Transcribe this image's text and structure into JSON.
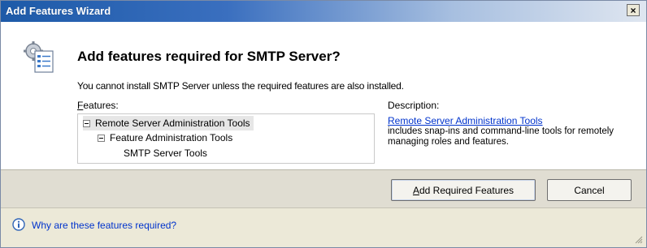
{
  "window": {
    "title": "Add Features Wizard",
    "close_glyph": "×"
  },
  "header": {
    "heading": "Add features required for SMTP Server?",
    "subtext": "You cannot install SMTP Server unless the required features are also installed.",
    "icon": "wizard-gear-document-icon"
  },
  "features": {
    "label_prefix": "",
    "label_mnemonic": "F",
    "label_rest": "eatures:",
    "tree": [
      {
        "label": "Remote Server Administration Tools",
        "expanded": true,
        "selected": true
      },
      {
        "label": "Feature Administration Tools",
        "expanded": true,
        "selected": false
      },
      {
        "label": "SMTP Server Tools",
        "expanded": null,
        "selected": false
      }
    ]
  },
  "description": {
    "label": "Description:",
    "link": "Remote Server Administration Tools",
    "text": "includes snap-ins and command-line tools for remotely managing roles and features."
  },
  "buttons": {
    "add_mnemonic": "A",
    "add_rest": "dd Required Features",
    "cancel": "Cancel"
  },
  "footer": {
    "help_link": "Why are these features required?",
    "info_icon": "info-icon"
  },
  "colors": {
    "title_bar": "#1d5aa8",
    "link": "#0033cc",
    "dialog_bg": "#ece9d8"
  }
}
